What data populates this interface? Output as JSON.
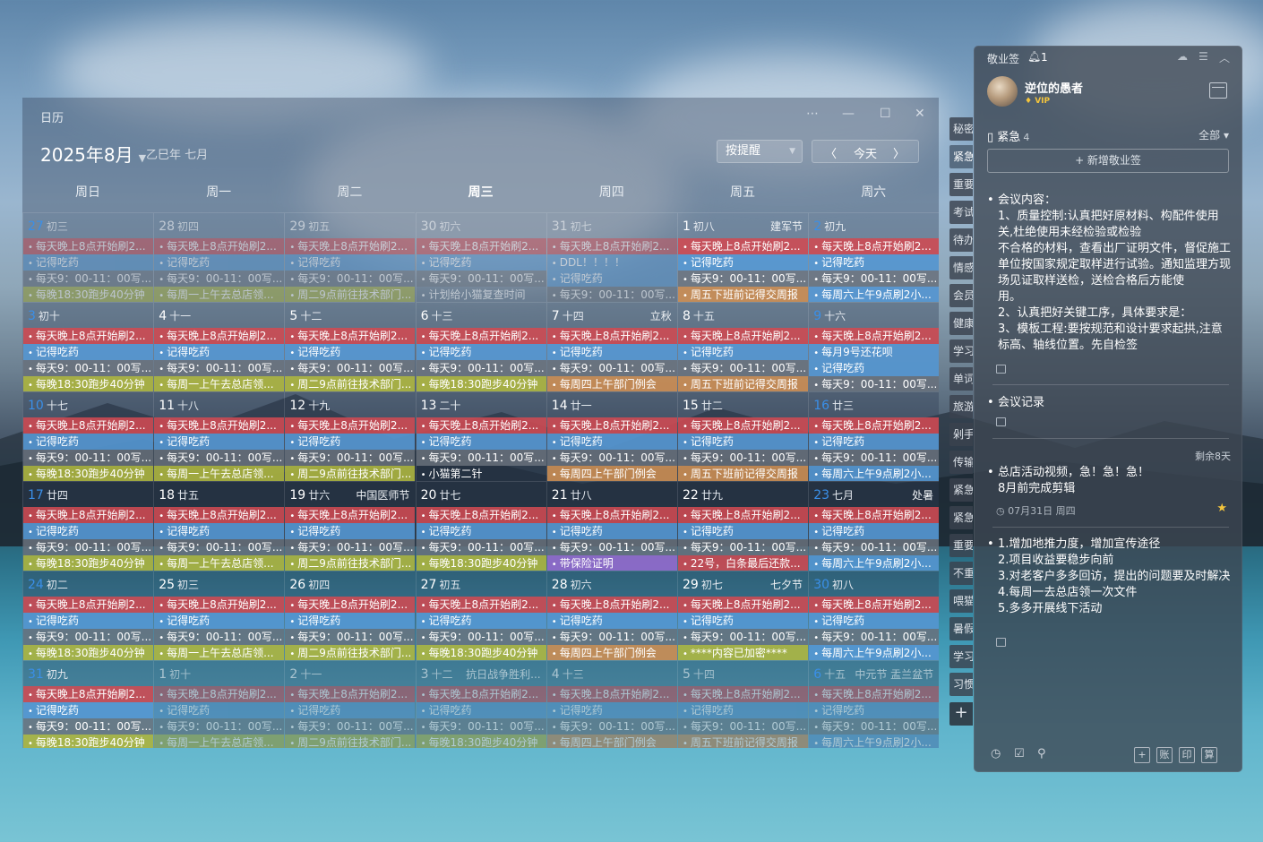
{
  "calendar": {
    "window_title": "日历",
    "month": "2025年8月",
    "lunar_year": "乙巳年 七月",
    "view_select": "按提醒",
    "today_label": "今天",
    "weekdays": [
      "周日",
      "周一",
      "周二",
      "周三",
      "周四",
      "周五",
      "周六"
    ],
    "today_weekday_index": 3,
    "weeks": [
      [
        {
          "day": "27",
          "lunar": "初三",
          "dim": true,
          "style": "blue",
          "events": [
            [
              "每天晚上8点开始刷2...",
              "red"
            ],
            [
              "记得吃药",
              "blue"
            ],
            [
              "每天9：00-11：00写...",
              "grey"
            ],
            [
              "每晚18:30跑步40分钟",
              "olive"
            ]
          ]
        },
        {
          "day": "28",
          "lunar": "初四",
          "dim": true,
          "events": [
            [
              "每天晚上8点开始刷2...",
              "red"
            ],
            [
              "记得吃药",
              "blue"
            ],
            [
              "每天9：00-11：00写...",
              "grey"
            ],
            [
              "每周一上午去总店领...",
              "olive"
            ]
          ]
        },
        {
          "day": "29",
          "lunar": "初五",
          "dim": true,
          "events": [
            [
              "每天晚上8点开始刷2...",
              "red"
            ],
            [
              "记得吃药",
              "blue"
            ],
            [
              "每天9：00-11：00写...",
              "grey"
            ],
            [
              "周二9点前往技术部门...",
              "olive"
            ]
          ]
        },
        {
          "day": "30",
          "lunar": "初六",
          "dim": true,
          "events": [
            [
              "每天晚上8点开始刷2...",
              "red"
            ],
            [
              "记得吃药",
              "blue"
            ],
            [
              "每天9：00-11：00写...",
              "grey"
            ],
            [
              "计划给小猫复查时间",
              "none"
            ]
          ]
        },
        {
          "day": "31",
          "lunar": "初七",
          "dim": true,
          "events": [
            [
              "每天晚上8点开始刷2...",
              "red"
            ],
            [
              "DDL！！！！",
              "blue"
            ],
            [
              "记得吃药",
              "blue"
            ],
            [
              "每天9：00-11：00写...",
              "grey"
            ]
          ]
        },
        {
          "day": "1",
          "lunar": "初八",
          "festival": "建军节",
          "events": [
            [
              "每天晚上8点开始刷2...",
              "red"
            ],
            [
              "记得吃药",
              "blue"
            ],
            [
              "每天9：00-11：00写...",
              "grey"
            ],
            [
              "周五下班前记得交周报",
              "orange"
            ]
          ]
        },
        {
          "day": "2",
          "lunar": "初九",
          "style": "blue",
          "events": [
            [
              "每天晚上8点开始刷2...",
              "red"
            ],
            [
              "记得吃药",
              "blue"
            ],
            [
              "每天9：00-11：00写...",
              "grey"
            ],
            [
              "每周六上午9点刷2小...",
              "blue"
            ]
          ]
        }
      ],
      [
        {
          "day": "3",
          "lunar": "初十",
          "style": "blue",
          "events": [
            [
              "每天晚上8点开始刷2...",
              "red"
            ],
            [
              "记得吃药",
              "blue"
            ],
            [
              "每天9：00-11：00写...",
              "grey"
            ],
            [
              "每晚18:30跑步40分钟",
              "olive"
            ]
          ]
        },
        {
          "day": "4",
          "lunar": "十一",
          "events": [
            [
              "每天晚上8点开始刷2...",
              "red"
            ],
            [
              "记得吃药",
              "blue"
            ],
            [
              "每天9：00-11：00写...",
              "grey"
            ],
            [
              "每周一上午去总店领...",
              "olive"
            ]
          ]
        },
        {
          "day": "5",
          "lunar": "十二",
          "events": [
            [
              "每天晚上8点开始刷2...",
              "red"
            ],
            [
              "记得吃药",
              "blue"
            ],
            [
              "每天9：00-11：00写...",
              "grey"
            ],
            [
              "周二9点前往技术部门...",
              "olive"
            ]
          ]
        },
        {
          "day": "6",
          "lunar": "十三",
          "events": [
            [
              "每天晚上8点开始刷2...",
              "red"
            ],
            [
              "记得吃药",
              "blue"
            ],
            [
              "每天9：00-11：00写...",
              "grey"
            ],
            [
              "每晚18:30跑步40分钟",
              "olive"
            ]
          ]
        },
        {
          "day": "7",
          "lunar": "十四",
          "festival": "立秋",
          "events": [
            [
              "每天晚上8点开始刷2...",
              "red"
            ],
            [
              "记得吃药",
              "blue"
            ],
            [
              "每天9：00-11：00写...",
              "grey"
            ],
            [
              "每周四上午部门例会",
              "orange"
            ]
          ]
        },
        {
          "day": "8",
          "lunar": "十五",
          "events": [
            [
              "每天晚上8点开始刷2...",
              "red"
            ],
            [
              "记得吃药",
              "blue"
            ],
            [
              "每天9：00-11：00写...",
              "grey"
            ],
            [
              "周五下班前记得交周报",
              "orange"
            ]
          ]
        },
        {
          "day": "9",
          "lunar": "十六",
          "style": "blue",
          "events": [
            [
              "每天晚上8点开始刷2...",
              "red"
            ],
            [
              "每月9号还花呗",
              "blue"
            ],
            [
              "记得吃药",
              "blue"
            ],
            [
              "每天9：00-11：00写...",
              "grey"
            ]
          ]
        }
      ],
      [
        {
          "day": "10",
          "lunar": "十七",
          "style": "blue",
          "events": [
            [
              "每天晚上8点开始刷2...",
              "red"
            ],
            [
              "记得吃药",
              "blue"
            ],
            [
              "每天9：00-11：00写...",
              "grey"
            ],
            [
              "每晚18:30跑步40分钟",
              "olive"
            ]
          ]
        },
        {
          "day": "11",
          "lunar": "十八",
          "events": [
            [
              "每天晚上8点开始刷2...",
              "red"
            ],
            [
              "记得吃药",
              "blue"
            ],
            [
              "每天9：00-11：00写...",
              "grey"
            ],
            [
              "每周一上午去总店领...",
              "olive"
            ]
          ]
        },
        {
          "day": "12",
          "lunar": "十九",
          "events": [
            [
              "每天晚上8点开始刷2...",
              "red"
            ],
            [
              "记得吃药",
              "blue"
            ],
            [
              "每天9：00-11：00写...",
              "grey"
            ],
            [
              "周二9点前往技术部门...",
              "olive"
            ]
          ]
        },
        {
          "day": "13",
          "lunar": "二十",
          "events": [
            [
              "每天晚上8点开始刷2...",
              "red"
            ],
            [
              "记得吃药",
              "blue"
            ],
            [
              "每天9：00-11：00写...",
              "grey"
            ],
            [
              "小猫第二针",
              "none"
            ]
          ]
        },
        {
          "day": "14",
          "lunar": "廿一",
          "events": [
            [
              "每天晚上8点开始刷2...",
              "red"
            ],
            [
              "记得吃药",
              "blue"
            ],
            [
              "每天9：00-11：00写...",
              "grey"
            ],
            [
              "每周四上午部门例会",
              "orange"
            ]
          ]
        },
        {
          "day": "15",
          "lunar": "廿二",
          "events": [
            [
              "每天晚上8点开始刷2...",
              "red"
            ],
            [
              "记得吃药",
              "blue"
            ],
            [
              "每天9：00-11：00写...",
              "grey"
            ],
            [
              "周五下班前记得交周报",
              "orange"
            ]
          ]
        },
        {
          "day": "16",
          "lunar": "廿三",
          "style": "blue",
          "events": [
            [
              "每天晚上8点开始刷2...",
              "red"
            ],
            [
              "记得吃药",
              "blue"
            ],
            [
              "每天9：00-11：00写...",
              "grey"
            ],
            [
              "每周六上午9点刷2小...",
              "blue"
            ]
          ]
        }
      ],
      [
        {
          "day": "17",
          "lunar": "廿四",
          "style": "blue",
          "events": [
            [
              "每天晚上8点开始刷2...",
              "red"
            ],
            [
              "记得吃药",
              "blue"
            ],
            [
              "每天9：00-11：00写...",
              "grey"
            ],
            [
              "每晚18:30跑步40分钟",
              "olive"
            ]
          ]
        },
        {
          "day": "18",
          "lunar": "廿五",
          "events": [
            [
              "每天晚上8点开始刷2...",
              "red"
            ],
            [
              "记得吃药",
              "blue"
            ],
            [
              "每天9：00-11：00写...",
              "grey"
            ],
            [
              "每周一上午去总店领...",
              "olive"
            ]
          ]
        },
        {
          "day": "19",
          "lunar": "廿六",
          "festival": "中国医师节",
          "events": [
            [
              "每天晚上8点开始刷2...",
              "red"
            ],
            [
              "记得吃药",
              "blue"
            ],
            [
              "每天9：00-11：00写...",
              "grey"
            ],
            [
              "周二9点前往技术部门...",
              "olive"
            ]
          ]
        },
        {
          "day": "20",
          "lunar": "廿七",
          "events": [
            [
              "每天晚上8点开始刷2...",
              "red"
            ],
            [
              "记得吃药",
              "blue"
            ],
            [
              "每天9：00-11：00写...",
              "grey"
            ],
            [
              "每晚18:30跑步40分钟",
              "olive"
            ]
          ]
        },
        {
          "day": "21",
          "lunar": "廿八",
          "events": [
            [
              "每天晚上8点开始刷2...",
              "red"
            ],
            [
              "记得吃药",
              "blue"
            ],
            [
              "每天9：00-11：00写...",
              "grey"
            ],
            [
              "带保险证明",
              "purple"
            ]
          ]
        },
        {
          "day": "22",
          "lunar": "廿九",
          "events": [
            [
              "每天晚上8点开始刷2...",
              "red"
            ],
            [
              "记得吃药",
              "blue"
            ],
            [
              "每天9：00-11：00写...",
              "grey"
            ],
            [
              "22号，白条最后还款...",
              "red"
            ]
          ]
        },
        {
          "day": "23",
          "lunar": "七月",
          "festival": "处暑",
          "style": "blue",
          "events": [
            [
              "每天晚上8点开始刷2...",
              "red"
            ],
            [
              "记得吃药",
              "blue"
            ],
            [
              "每天9：00-11：00写...",
              "grey"
            ],
            [
              "每周六上午9点刷2小...",
              "blue"
            ]
          ]
        }
      ],
      [
        {
          "day": "24",
          "lunar": "初二",
          "style": "blue",
          "events": [
            [
              "每天晚上8点开始刷2...",
              "red"
            ],
            [
              "记得吃药",
              "blue"
            ],
            [
              "每天9：00-11：00写...",
              "grey"
            ],
            [
              "每晚18:30跑步40分钟",
              "olive"
            ]
          ]
        },
        {
          "day": "25",
          "lunar": "初三",
          "events": [
            [
              "每天晚上8点开始刷2...",
              "red"
            ],
            [
              "记得吃药",
              "blue"
            ],
            [
              "每天9：00-11：00写...",
              "grey"
            ],
            [
              "每周一上午去总店领...",
              "olive"
            ]
          ]
        },
        {
          "day": "26",
          "lunar": "初四",
          "events": [
            [
              "每天晚上8点开始刷2...",
              "red"
            ],
            [
              "记得吃药",
              "blue"
            ],
            [
              "每天9：00-11：00写...",
              "grey"
            ],
            [
              "周二9点前往技术部门...",
              "olive"
            ]
          ]
        },
        {
          "day": "27",
          "lunar": "初五",
          "events": [
            [
              "每天晚上8点开始刷2...",
              "red"
            ],
            [
              "记得吃药",
              "blue"
            ],
            [
              "每天9：00-11：00写...",
              "grey"
            ],
            [
              "每晚18:30跑步40分钟",
              "olive"
            ]
          ]
        },
        {
          "day": "28",
          "lunar": "初六",
          "events": [
            [
              "每天晚上8点开始刷2...",
              "red"
            ],
            [
              "记得吃药",
              "blue"
            ],
            [
              "每天9：00-11：00写...",
              "grey"
            ],
            [
              "每周四上午部门例会",
              "orange"
            ]
          ]
        },
        {
          "day": "29",
          "lunar": "初七",
          "festival": "七夕节",
          "events": [
            [
              "每天晚上8点开始刷2...",
              "red"
            ],
            [
              "记得吃药",
              "blue"
            ],
            [
              "每天9：00-11：00写...",
              "grey"
            ],
            [
              "****内容已加密****",
              "olive"
            ]
          ]
        },
        {
          "day": "30",
          "lunar": "初八",
          "style": "blue",
          "events": [
            [
              "每天晚上8点开始刷2...",
              "red"
            ],
            [
              "记得吃药",
              "blue"
            ],
            [
              "每天9：00-11：00写...",
              "grey"
            ],
            [
              "每周六上午9点刷2小...",
              "blue"
            ]
          ]
        }
      ],
      [
        {
          "day": "31",
          "lunar": "初九",
          "style": "blue",
          "events": [
            [
              "每天晚上8点开始刷2...",
              "red"
            ],
            [
              "记得吃药",
              "blue"
            ],
            [
              "每天9：00-11：00写...",
              "grey"
            ],
            [
              "每晚18:30跑步40分钟",
              "olive"
            ]
          ]
        },
        {
          "day": "1",
          "lunar": "初十",
          "dim": true,
          "events": [
            [
              "每天晚上8点开始刷2...",
              "red"
            ],
            [
              "记得吃药",
              "blue"
            ],
            [
              "每天9：00-11：00写...",
              "grey"
            ],
            [
              "每周一上午去总店领...",
              "olive"
            ]
          ]
        },
        {
          "day": "2",
          "lunar": "十一",
          "dim": true,
          "events": [
            [
              "每天晚上8点开始刷2...",
              "red"
            ],
            [
              "记得吃药",
              "blue"
            ],
            [
              "每天9：00-11：00写...",
              "grey"
            ],
            [
              "周二9点前往技术部门...",
              "olive"
            ]
          ]
        },
        {
          "day": "3",
          "lunar": "十二",
          "festival": "抗日战争胜利...",
          "dim": true,
          "events": [
            [
              "每天晚上8点开始刷2...",
              "red"
            ],
            [
              "记得吃药",
              "blue"
            ],
            [
              "每天9：00-11：00写...",
              "grey"
            ],
            [
              "每晚18:30跑步40分钟",
              "olive"
            ]
          ]
        },
        {
          "day": "4",
          "lunar": "十三",
          "dim": true,
          "events": [
            [
              "每天晚上8点开始刷2...",
              "red"
            ],
            [
              "记得吃药",
              "blue"
            ],
            [
              "每天9：00-11：00写...",
              "grey"
            ],
            [
              "每周四上午部门例会",
              "orange"
            ]
          ]
        },
        {
          "day": "5",
          "lunar": "十四",
          "dim": true,
          "events": [
            [
              "每天晚上8点开始刷2...",
              "red"
            ],
            [
              "记得吃药",
              "blue"
            ],
            [
              "每天9：00-11：00写...",
              "grey"
            ],
            [
              "周五下班前记得交周报",
              "orange"
            ]
          ]
        },
        {
          "day": "6",
          "lunar": "十五",
          "festival": "中元节 盂兰盆节",
          "dim": true,
          "style": "blue",
          "events": [
            [
              "每天晚上8点开始刷2...",
              "red"
            ],
            [
              "记得吃药",
              "blue"
            ],
            [
              "每天9：00-11：00写...",
              "grey"
            ],
            [
              "每周六上午9点刷2小...",
              "blue"
            ]
          ]
        }
      ]
    ]
  },
  "side_tabs": [
    "秘密",
    "紧急",
    "重要",
    "考试",
    "待办",
    "情感",
    "会员",
    "健康",
    "学习",
    "单词",
    "旅游",
    "剁手",
    "传输",
    "紧急",
    "紧急",
    "重要",
    "不重",
    "喂猫",
    "暑假",
    "学习",
    "习惯"
  ],
  "side_tabs_active_index": 1,
  "note": {
    "app_title": "敬业签",
    "bell_count": "1",
    "username": "逆位的愚者",
    "vip": "VIP",
    "category": "紧急",
    "category_count": "4",
    "filter": "全部",
    "add_button": "+ 新增敬业签",
    "items": [
      {
        "text": "会议内容：\n1、质量控制:认真把好原材料、构配件使用关,杜绝使用未经检验或检验\n不合格的材料，查看出厂证明文件，督促施工单位按国家规定取样进行试验。通知监理方现场见证取样送检，送检合格后方能使\n用。\n2、认真把好关键工序，具体要求是：\n3、模板工程:要按规范和设计要求起拱,注意标高、轴线位置。先自检签"
      },
      {
        "text": "会议记录"
      },
      {
        "text": "总店活动视频，急！急！急！\n8月前完成剪辑",
        "remain": "剩余8天",
        "date": "07月31日 周四"
      },
      {
        "text": "1.增加地推力度，增加宣传途径\n2.项目收益要稳步向前\n3.对老客户多多回访，提出的问题要及时解决\n4.每周一去总店领一次文件\n5.多多开展线下活动"
      }
    ],
    "bottom_boxes": [
      "+",
      "账",
      "印",
      "算"
    ]
  }
}
